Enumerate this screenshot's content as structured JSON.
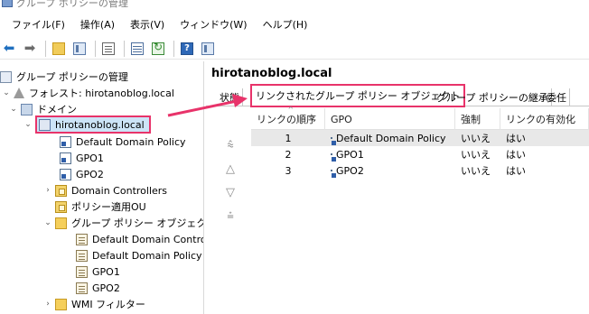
{
  "window": {
    "title": "グループ ポリシーの管理"
  },
  "menu": [
    {
      "label": "ファイル(F)"
    },
    {
      "label": "操作(A)"
    },
    {
      "label": "表示(V)"
    },
    {
      "label": "ウィンドウ(W)"
    },
    {
      "label": "ヘルプ(H)"
    }
  ],
  "toolbar": [
    {
      "icon": "back-arrow-icon"
    },
    {
      "icon": "forward-arrow-icon"
    },
    {
      "icon": "up-folder-icon"
    },
    {
      "icon": "show-pane-icon"
    },
    {
      "icon": "properties-icon"
    },
    {
      "icon": "export-list-icon"
    },
    {
      "icon": "refresh-icon"
    },
    {
      "icon": "help-icon"
    },
    {
      "icon": "action-pane-icon"
    }
  ],
  "tree": {
    "root": "グループ ポリシーの管理",
    "forest": "フォレスト: hirotanoblog.local",
    "domains": "ドメイン",
    "domain": "hirotanoblog.local",
    "children": [
      {
        "label": "Default Domain Policy",
        "icon": "gpo-link-icon"
      },
      {
        "label": "GPO1",
        "icon": "gpo-link-icon"
      },
      {
        "label": "GPO2",
        "icon": "gpo-link-icon"
      },
      {
        "label": "Domain Controllers",
        "icon": "ou-icon"
      },
      {
        "label": "ポリシー適用OU",
        "icon": "ou-icon"
      },
      {
        "label": "グループ ポリシー オブジェクト",
        "icon": "gpo-folder-icon"
      }
    ],
    "gpo_objects": [
      {
        "label": "Default Domain Contro"
      },
      {
        "label": "Default Domain Policy"
      },
      {
        "label": "GPO1"
      },
      {
        "label": "GPO2"
      }
    ],
    "wmi": "WMI フィルター"
  },
  "right": {
    "title": "hirotanoblog.local",
    "tabs": [
      {
        "label": "状態"
      },
      {
        "label": "リンクされたグループ ポリシー オブジェクト"
      },
      {
        "label": "グループ ポリシーの継承"
      },
      {
        "label": "委任"
      }
    ],
    "active_tab": 1,
    "columns": [
      "リンクの順序",
      "GPO",
      "強制",
      "リンクの有効化"
    ],
    "rows": [
      {
        "order": "1",
        "gpo": "Default Domain Policy",
        "enforced": "いいえ",
        "enabled": "はい"
      },
      {
        "order": "2",
        "gpo": "GPO1",
        "enforced": "いいえ",
        "enabled": "はい"
      },
      {
        "order": "3",
        "gpo": "GPO2",
        "enforced": "いいえ",
        "enabled": "はい"
      }
    ]
  },
  "colors": {
    "highlight": "#e8336a",
    "selection": "#cce4f7"
  }
}
